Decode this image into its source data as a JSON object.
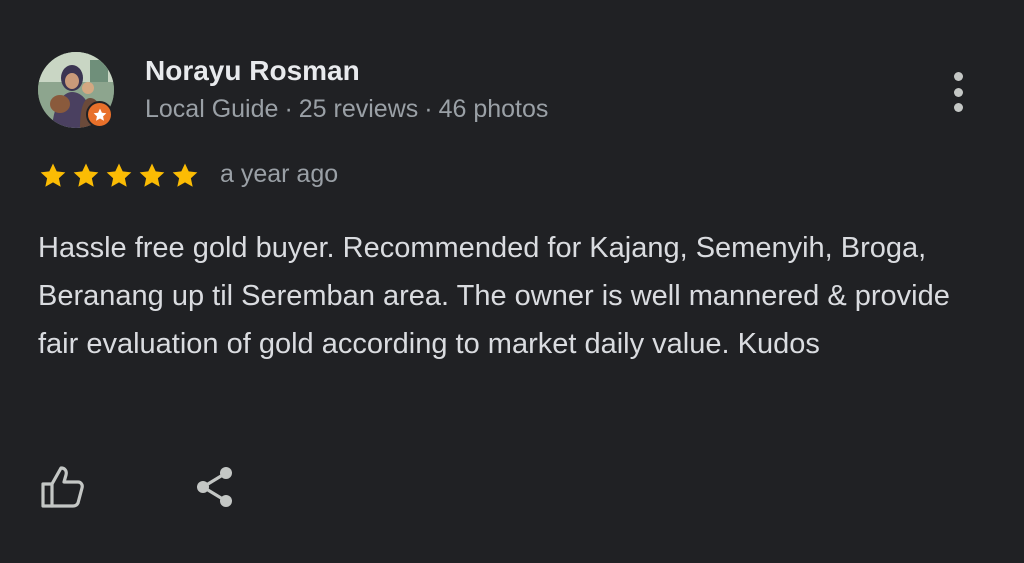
{
  "reviewer": {
    "name": "Norayu Rosman",
    "level": "Local Guide",
    "separator": "·",
    "reviews": "25 reviews",
    "photos": "46 photos",
    "avatar_icon": "profile-photo",
    "badge_icon": "local-guide-star-badge",
    "badge_color": "#e8702a"
  },
  "rating": {
    "stars": 5,
    "max_stars": 5,
    "star_color": "#fbbc04",
    "age": "a year ago"
  },
  "review": {
    "text": "Hassle free gold buyer. Recommended for Kajang, Semenyih, Broga, Beranang up til Seremban area. The owner is well mannered & provide fair evaluation of gold according to market daily value. Kudos"
  },
  "actions": {
    "more_icon": "more-vert-icon",
    "like_icon": "thumb-up-icon",
    "share_icon": "share-icon"
  },
  "colors": {
    "background": "#202124",
    "primary_text": "#e8eaed",
    "secondary_text": "#9aa0a6",
    "icon": "#c4c7c5"
  }
}
